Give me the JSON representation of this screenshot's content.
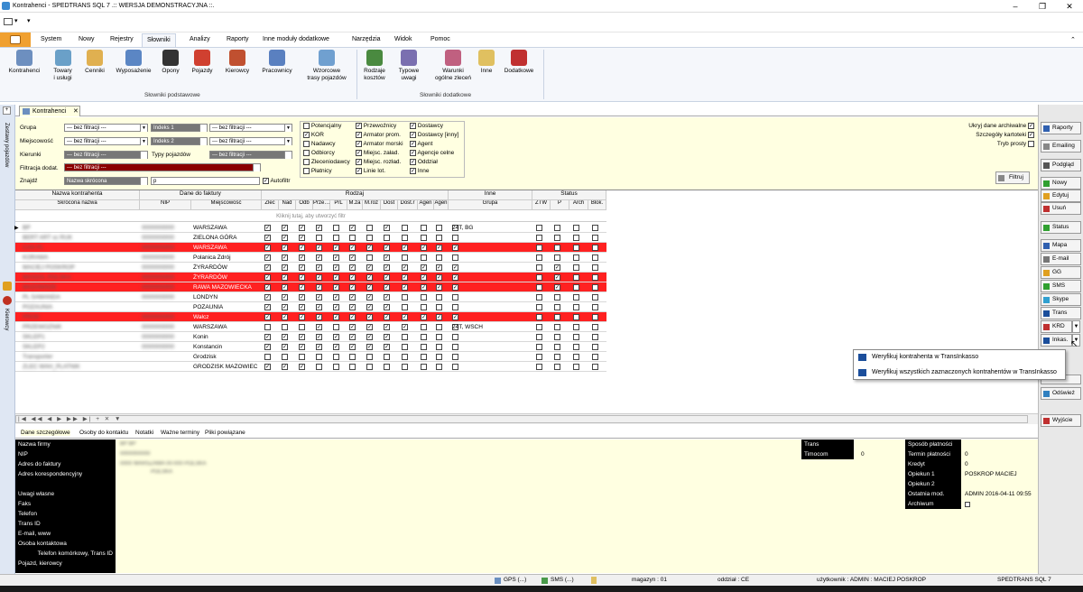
{
  "window": {
    "title": "Kontrahenci - SPEDTRANS SQL 7 .:: WERSJA DEMONSTRACYJNA ::."
  },
  "menu": {
    "tabs": [
      "System",
      "Nowy",
      "Rejestry",
      "Słowniki",
      "Analizy",
      "Raporty",
      "Inne moduły dodatkowe",
      "Narzędzia",
      "Widok",
      "Pomoc"
    ],
    "active": "Słowniki"
  },
  "ribbon": {
    "buttons": [
      {
        "label": "Kontrahenci",
        "color": "#6d8fbf"
      },
      {
        "label": "Towary\nі usługi",
        "color": "#6aa0c8"
      },
      {
        "label": "Cenniki",
        "color": "#e0b050"
      },
      {
        "label": "Wyposażenie",
        "color": "#5b86c4"
      },
      {
        "label": "Opony",
        "color": "#333333"
      },
      {
        "label": "Pojazdy",
        "color": "#d04030"
      },
      {
        "label": "Kierowcy",
        "color": "#c05030"
      },
      {
        "label": "Pracownicy",
        "color": "#5a80c0"
      },
      {
        "label": "Wzorcowe\ntrasy pojazdów",
        "color": "#70a0d0"
      },
      {
        "label": "Rodzaje\nkosztów",
        "color": "#4a8a40"
      },
      {
        "label": "Typowe\nuwagi",
        "color": "#7a6fb0"
      },
      {
        "label": "Warunki\nogólne zleceń",
        "color": "#c06080"
      },
      {
        "label": "Inne",
        "color": "#e0c060"
      },
      {
        "label": "Dodatkowe",
        "color": "#c03030"
      }
    ],
    "groups": [
      "Słowniki podstawowe",
      "Słowniki dodatkowe"
    ]
  },
  "doc_tab": "Kontrahenci",
  "left_strip": [
    "Zestawy pojazdów",
    "Kierowcy"
  ],
  "filter": {
    "grupa_label": "Grupa",
    "grupa_value": "--- bez filtracji ---",
    "indeks1": "Indeks 1",
    "indeks1_val": "--- bez filtracji ---",
    "miejscowosc_label": "Miejscowość",
    "miejscowosc_value": "--- bez filtracji ---",
    "indeks2": "Indeks 2",
    "indeks2_val": "--- bez filtracji ---",
    "kierunki_label": "Kierunki",
    "kierunki_value": "--- bez filtracji ---",
    "typy_label": "Typy pojazdów",
    "typy_value": "--- bez filtracji ---",
    "filtracja_label": "Filtracja dodat.",
    "filtracja_value": "--- bez filtracji ---",
    "znajdz_label": "Znajdź",
    "znajdz_field": "Nazwa skrócona",
    "znajdz_value": "p",
    "autofiltr": "Autofiltr",
    "checks_col1": [
      [
        "Potencjalny",
        false
      ],
      [
        "KOR",
        true
      ],
      [
        "Nadawcy",
        false
      ],
      [
        "Odbiorcy",
        false
      ],
      [
        "Zleceniodawcy",
        false
      ],
      [
        "Płatnicy",
        false
      ]
    ],
    "checks_col2": [
      [
        "Przewoźnicy",
        true
      ],
      [
        "Armator prom.",
        true
      ],
      [
        "Armator morski",
        true
      ],
      [
        "Miejsc. załad.",
        true
      ],
      [
        "Miejsc. rozład.",
        true
      ],
      [
        "Linie lot.",
        true
      ]
    ],
    "checks_col3": [
      [
        "Dostawcy",
        true
      ],
      [
        "Dostawcy [inny]",
        true
      ],
      [
        "Agent",
        true
      ],
      [
        "Agencje celne",
        true
      ],
      [
        "Oddział",
        true
      ],
      [
        "Inne",
        true
      ]
    ],
    "filtruj": "Filtruj",
    "right_checks": [
      [
        "Ukryj dane archiwalne",
        true
      ],
      [
        "Szczegóły kartoteki",
        true
      ],
      [
        "Tryb prosty",
        false
      ]
    ]
  },
  "grid": {
    "group_headers": [
      "Nazwa kontrahenta",
      "Dane do faktury",
      "Rodzaj",
      "Inne",
      "Status"
    ],
    "col_headers": [
      "Skrócona nazwa",
      "NIP",
      "Miejscowość",
      "Zlec",
      "Nad",
      "Odb",
      "Prze…",
      "PrL",
      "M.za",
      "M.roz",
      "Dost",
      "Dost.r",
      "Agen",
      "Agen",
      "Grupa",
      "ZTW",
      "P",
      "Arch",
      "Blok."
    ],
    "placeholder": "Kliknij tutaj, aby utworzyć filtr",
    "rows": [
      {
        "name": "BP",
        "nip": "0000000000",
        "city": "WARSZAWA",
        "red": false,
        "checks": [
          1,
          1,
          1,
          1,
          0,
          1,
          0,
          1,
          0,
          0,
          0,
          0
        ],
        "grupa": "24T, BG",
        "status": [
          0,
          0,
          0,
          0
        ]
      },
      {
        "name": "BERT ART sc RUK",
        "nip": "0000000000",
        "city": "ZIELONA GÓRA",
        "red": false,
        "checks": [
          1,
          1,
          1,
          0,
          0,
          0,
          0,
          0,
          0,
          0,
          0,
          0
        ],
        "grupa": "",
        "status": [
          0,
          0,
          0,
          0
        ]
      },
      {
        "name": "CAN PL",
        "nip": "0000000000",
        "city": "WARSZAWA",
        "red": true,
        "checks": [
          1,
          1,
          1,
          1,
          1,
          1,
          1,
          1,
          1,
          1,
          1,
          1
        ],
        "grupa": "",
        "status": [
          0,
          0,
          0,
          0
        ]
      },
      {
        "name": "KORAWA",
        "nip": "0000000000",
        "city": "Polanica Zdrój",
        "red": false,
        "checks": [
          1,
          1,
          1,
          1,
          1,
          1,
          0,
          1,
          0,
          0,
          0,
          0
        ],
        "grupa": "",
        "status": [
          0,
          0,
          0,
          0
        ]
      },
      {
        "name": "MACIEJ POSKROP",
        "nip": "0000000000",
        "city": "ŻYRARDÓW",
        "red": false,
        "checks": [
          1,
          1,
          1,
          1,
          1,
          1,
          1,
          1,
          1,
          1,
          1,
          1
        ],
        "grupa": "",
        "status": [
          0,
          1,
          0,
          0
        ]
      },
      {
        "name": "MASZAL POLSKA",
        "nip": "0000000000",
        "city": "ŻYRARDÓW",
        "red": true,
        "checks": [
          1,
          1,
          1,
          1,
          1,
          1,
          1,
          1,
          1,
          1,
          1,
          1
        ],
        "grupa": "",
        "status": [
          0,
          1,
          0,
          0
        ]
      },
      {
        "name": "MAZOWSZE",
        "nip": "0000000000",
        "city": "RAWA MAZOWIECKA",
        "red": true,
        "checks": [
          1,
          1,
          1,
          1,
          1,
          1,
          1,
          1,
          1,
          1,
          1,
          1
        ],
        "grupa": "",
        "status": [
          0,
          1,
          0,
          0
        ]
      },
      {
        "name": "PL SAMANDA",
        "nip": "0000000000",
        "city": "LONDYN",
        "red": false,
        "checks": [
          1,
          1,
          1,
          1,
          1,
          1,
          1,
          1,
          0,
          0,
          0,
          0
        ],
        "grupa": "",
        "status": [
          0,
          0,
          0,
          0
        ]
      },
      {
        "name": "POZAUNIA",
        "nip": "",
        "city": "POZAUNIA",
        "red": false,
        "checks": [
          1,
          1,
          1,
          1,
          1,
          1,
          1,
          1,
          0,
          0,
          0,
          0
        ],
        "grupa": "",
        "status": [
          0,
          0,
          0,
          0
        ]
      },
      {
        "name": "PROD",
        "nip": "0000000000",
        "city": "Wałcz",
        "red": true,
        "checks": [
          1,
          1,
          1,
          1,
          1,
          1,
          1,
          1,
          1,
          1,
          1,
          1
        ],
        "grupa": "",
        "status": [
          0,
          0,
          0,
          0
        ]
      },
      {
        "name": "PRZEWOZNIK",
        "nip": "0000000000",
        "city": "WARSZAWA",
        "red": false,
        "checks": [
          0,
          0,
          0,
          1,
          0,
          1,
          1,
          1,
          1,
          0,
          0,
          0
        ],
        "grupa": "24T, WSCH",
        "status": [
          0,
          0,
          0,
          0
        ]
      },
      {
        "name": "SKLEP1",
        "nip": "0000000000",
        "city": "Konin",
        "red": false,
        "checks": [
          1,
          1,
          1,
          1,
          1,
          1,
          1,
          1,
          0,
          0,
          0,
          0
        ],
        "grupa": "",
        "status": [
          0,
          0,
          0,
          0
        ]
      },
      {
        "name": "SKLEP2",
        "nip": "0000000000",
        "city": "Konstancin",
        "red": false,
        "checks": [
          1,
          1,
          1,
          1,
          1,
          1,
          1,
          1,
          0,
          0,
          0,
          0
        ],
        "grupa": "",
        "status": [
          0,
          0,
          0,
          0
        ]
      },
      {
        "name": "Transporter",
        "nip": "",
        "city": "Grodzisk",
        "red": false,
        "checks": [
          0,
          0,
          0,
          0,
          0,
          0,
          0,
          0,
          0,
          0,
          0,
          0
        ],
        "grupa": "",
        "status": [
          0,
          0,
          0,
          0
        ]
      },
      {
        "name": "ZLEC WAH_PLATNIK",
        "nip": "",
        "city": "GRODZISK MAZOWIEC",
        "red": false,
        "checks": [
          1,
          1,
          1,
          0,
          0,
          0,
          0,
          0,
          0,
          0,
          0,
          0
        ],
        "grupa": "",
        "status": [
          0,
          0,
          0,
          0
        ]
      }
    ]
  },
  "detail_tabs": [
    "Dane szczegółowe",
    "Osoby do kontaktu",
    "Notatki",
    "Ważne terminy",
    "Pliki powiązane"
  ],
  "detail": {
    "left_labels": [
      "Nazwa firmy",
      "NIP",
      "Adres do faktury",
      "Adres korespondencyjny",
      "",
      "Uwagi własne",
      "Faks",
      "Telefon",
      "Trans ID",
      "E-mail, www",
      "Osoba kontaktowa",
      "Telefon komórkowy, Trans ID",
      "Pojazd, kierowcy"
    ],
    "left_values": [
      "BP BP",
      "0000000000",
      "0000 WARSZAWA 00-000 POLSKA",
      "POLSKA"
    ],
    "mid_labels": [
      "Trans",
      "Timocom"
    ],
    "mid_values": [
      "",
      "0"
    ],
    "right_labels": [
      "Sposób płatności",
      "Termin płatności",
      "Kredyt",
      "Opiekun 1",
      "Opiekun 2",
      "Ostatnia mod.",
      "Archiwum"
    ],
    "right_values": [
      "",
      "0",
      "0",
      "POSKROP MACIEJ",
      "",
      "ADMIN 2016-04-11 09:55",
      ""
    ]
  },
  "right_panel": [
    "Raporty",
    "Emailing",
    "Podgląd",
    "Nowy",
    "Edytuj",
    "Usuń",
    "Status",
    "Mapa",
    "E-mail",
    "GG",
    "SMS",
    "Skype",
    "Trans",
    "KRD",
    "Inkas.",
    "Odśwież",
    "Wyjście"
  ],
  "popup": [
    "Weryfikuj kontrahenta w TransInkasso",
    "Weryfikuj wszystkich zaznaczonych kontrahentów w TransInkasso"
  ],
  "status": {
    "gps": "GPS (...)",
    "sms": "SMS (...)",
    "magazyn": "magazyn : 01",
    "oddzial": "oddział : CE",
    "user": "użytkownik : ADMIN : MACIEJ POSKROP",
    "app": "SPEDTRANS SQL 7"
  }
}
